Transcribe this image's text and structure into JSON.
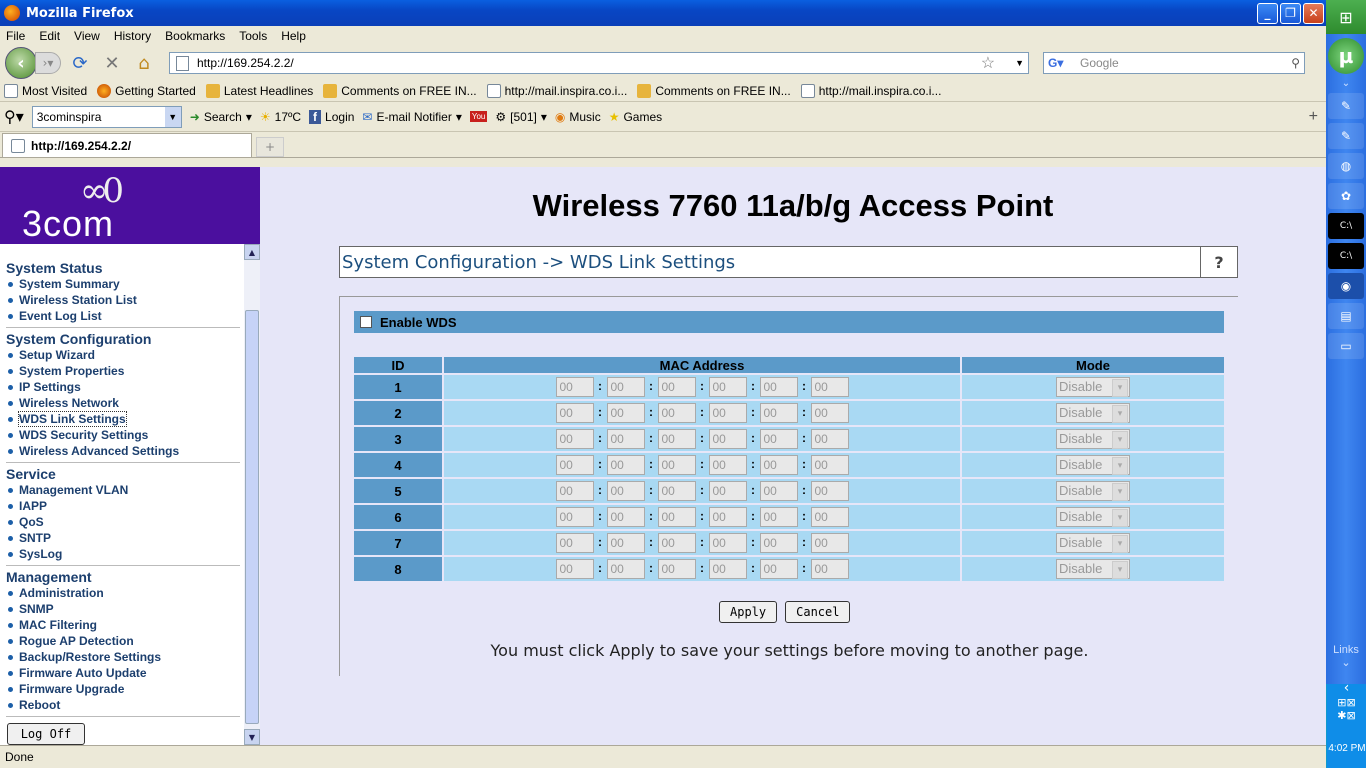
{
  "window": {
    "title": "Mozilla Firefox"
  },
  "menu": [
    "File",
    "Edit",
    "View",
    "History",
    "Bookmarks",
    "Tools",
    "Help"
  ],
  "nav": {
    "url": "http://169.254.2.2/",
    "search_placeholder": "Google"
  },
  "bookmarks": [
    {
      "label": "Most Visited",
      "icon": "folder-icon"
    },
    {
      "label": "Getting Started",
      "icon": "firefox-icon"
    },
    {
      "label": "Latest Headlines",
      "icon": "rss-icon"
    },
    {
      "label": "Comments on FREE IN...",
      "icon": "rss-icon"
    },
    {
      "label": "http://mail.inspira.co.i...",
      "icon": "page-icon"
    },
    {
      "label": "Comments on FREE IN...",
      "icon": "rss-icon"
    },
    {
      "label": "http://mail.inspira.co.i...",
      "icon": "page-icon"
    }
  ],
  "toolbar2": {
    "combo_value": "3cominspira",
    "search": "Search",
    "weather": "17ºC",
    "login": "Login",
    "email": "E-mail Notifier",
    "counter": "[501]",
    "music": "Music",
    "games": "Games"
  },
  "tab": {
    "label": "http://169.254.2.2/"
  },
  "page": {
    "logo": "3COM",
    "heading": "Wireless 7760 11a/b/g Access Point",
    "section_title": "System Configuration -> WDS Link Settings",
    "help": "?",
    "enable_wds": "Enable WDS",
    "columns": [
      "ID",
      "MAC Address",
      "Mode"
    ],
    "rows": [
      {
        "id": "1",
        "mac": [
          "00",
          "00",
          "00",
          "00",
          "00",
          "00"
        ],
        "mode": "Disable"
      },
      {
        "id": "2",
        "mac": [
          "00",
          "00",
          "00",
          "00",
          "00",
          "00"
        ],
        "mode": "Disable"
      },
      {
        "id": "3",
        "mac": [
          "00",
          "00",
          "00",
          "00",
          "00",
          "00"
        ],
        "mode": "Disable"
      },
      {
        "id": "4",
        "mac": [
          "00",
          "00",
          "00",
          "00",
          "00",
          "00"
        ],
        "mode": "Disable"
      },
      {
        "id": "5",
        "mac": [
          "00",
          "00",
          "00",
          "00",
          "00",
          "00"
        ],
        "mode": "Disable"
      },
      {
        "id": "6",
        "mac": [
          "00",
          "00",
          "00",
          "00",
          "00",
          "00"
        ],
        "mode": "Disable"
      },
      {
        "id": "7",
        "mac": [
          "00",
          "00",
          "00",
          "00",
          "00",
          "00"
        ],
        "mode": "Disable"
      },
      {
        "id": "8",
        "mac": [
          "00",
          "00",
          "00",
          "00",
          "00",
          "00"
        ],
        "mode": "Disable"
      }
    ],
    "apply": "Apply",
    "cancel": "Cancel",
    "note": "You must click Apply to save your settings before moving to another page."
  },
  "sidebar": {
    "sections": [
      {
        "title": "System Status",
        "items": [
          "System Summary",
          "Wireless Station List",
          "Event Log List"
        ]
      },
      {
        "title": "System Configuration",
        "items": [
          "Setup Wizard",
          "System Properties",
          "IP Settings",
          "Wireless Network",
          "WDS Link Settings",
          "WDS Security Settings",
          "Wireless Advanced Settings"
        ]
      },
      {
        "title": "Service",
        "items": [
          "Management VLAN",
          "IAPP",
          "QoS",
          "SNTP",
          "SysLog"
        ]
      },
      {
        "title": "Management",
        "items": [
          "Administration",
          "SNMP",
          "MAC Filtering",
          "Rogue AP Detection",
          "Backup/Restore Settings",
          "Firmware Auto Update",
          "Firmware Upgrade",
          "Reboot"
        ]
      }
    ],
    "active": "WDS Link Settings",
    "logoff": "Log Off"
  },
  "status": "Done",
  "taskbar": {
    "links": "Links",
    "clock": "4:02 PM"
  }
}
